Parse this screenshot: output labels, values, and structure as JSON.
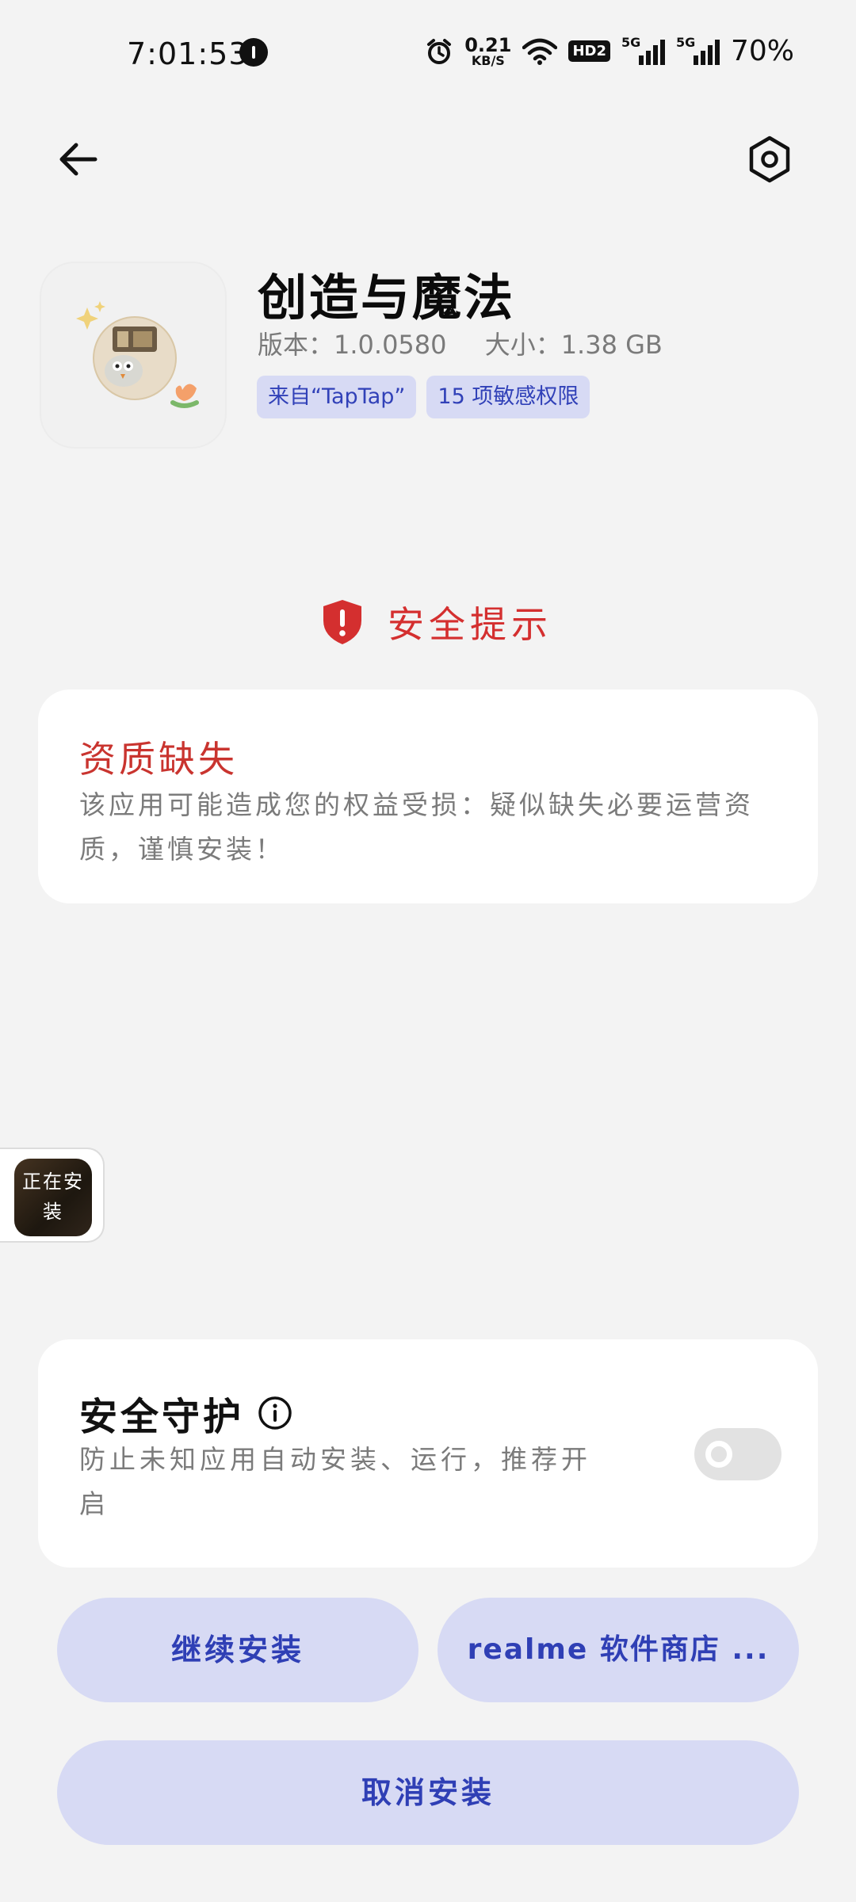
{
  "status_bar": {
    "time": "7:01:53",
    "net_speed_value": "0.21",
    "net_speed_unit": "KB/S",
    "hd_label": "HD2",
    "signal1_label": "5G",
    "signal2_label": "5G",
    "battery": "70%"
  },
  "header": {
    "back_icon": "arrow-left-icon",
    "settings_icon": "settings-hexagon-icon"
  },
  "app": {
    "name": "创造与魔法",
    "version": "版本：1.0.0580",
    "size": "大小：1.38 GB",
    "tags": [
      "来自“TapTap”",
      "15 项敏感权限"
    ]
  },
  "notice": {
    "title": "安全提示",
    "icon": "shield-warning-icon",
    "icon_color": "#d42f2f"
  },
  "risk": {
    "title": "资质缺失",
    "description": "该应用可能造成您的权益受损：疑似缺失必要运营资质，谨慎安装！"
  },
  "floating": {
    "label": "正在安装"
  },
  "protection": {
    "title": "安全守护",
    "info_icon": "info-circle-icon",
    "description": "防止未知应用自动安装、运行，推荐开启",
    "enabled": false
  },
  "actions": {
    "continue_label": "继续安装",
    "store_label": "realme 软件商店 ...",
    "cancel_label": "取消安装",
    "accent_color": "#2f3fb5",
    "button_bg": "#d7daf4"
  }
}
